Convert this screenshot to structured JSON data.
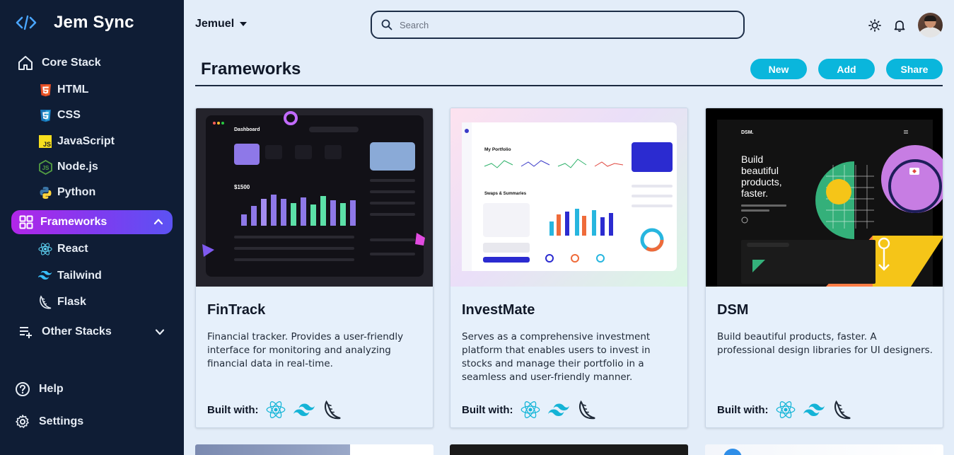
{
  "app": {
    "name": "Jem Sync"
  },
  "sidebar": {
    "core_stack": {
      "label": "Core Stack",
      "items": [
        {
          "label": "HTML",
          "icon": "html5-icon"
        },
        {
          "label": "CSS",
          "icon": "css3-icon"
        },
        {
          "label": "JavaScript",
          "icon": "javascript-icon"
        },
        {
          "label": "Node.js",
          "icon": "nodejs-icon"
        },
        {
          "label": "Python",
          "icon": "python-icon"
        }
      ]
    },
    "frameworks": {
      "label": "Frameworks",
      "items": [
        {
          "label": "React",
          "icon": "react-icon"
        },
        {
          "label": "Tailwind",
          "icon": "tailwind-icon"
        },
        {
          "label": "Flask",
          "icon": "flask-icon"
        }
      ]
    },
    "other_stacks": {
      "label": "Other Stacks"
    },
    "help": {
      "label": "Help"
    },
    "settings": {
      "label": "Settings"
    }
  },
  "topbar": {
    "user": "Jemuel",
    "search_placeholder": "Search"
  },
  "section": {
    "title": "Frameworks",
    "buttons": {
      "new": "New",
      "add": "Add",
      "share": "Share"
    }
  },
  "cards": [
    {
      "title": "FinTrack",
      "description": "Financial tracker. Provides a user-friendly interface for monitoring and analyzing financial data in real-time.",
      "built_with_label": "Built with:",
      "tech": [
        "react-icon",
        "tailwind-icon",
        "flask-icon"
      ],
      "thumb": {
        "heading": "Dashboard",
        "balance": "$1500"
      }
    },
    {
      "title": "InvestMate",
      "description": "Serves as a comprehensive investment platform that enables users to invest in stocks and manage their portfolio in a seamless and user-friendly manner.",
      "built_with_label": "Built with:",
      "tech": [
        "react-icon",
        "tailwind-icon",
        "flask-icon"
      ],
      "thumb": {
        "heading": "My Portfolio",
        "subheading": "Swaps & Summaries"
      }
    },
    {
      "title": "DSM",
      "description": "Build beautiful products, faster. A professional design libraries for UI designers.",
      "built_with_label": "Built with:",
      "tech": [
        "react-icon",
        "tailwind-icon",
        "flask-icon"
      ],
      "thumb": {
        "brand": "DSM.",
        "headline": "Build beautiful products, faster."
      }
    }
  ],
  "colors": {
    "sidebar": "#0f1d35",
    "accent": "#0ab6dc",
    "active_start": "#b126e8",
    "active_end": "#5b52f3",
    "background": "#e3edf9"
  }
}
